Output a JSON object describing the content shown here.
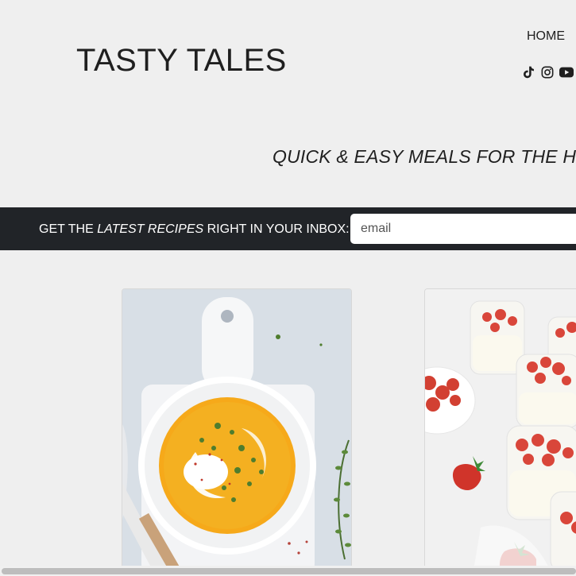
{
  "header": {
    "title": "TASTY TALES",
    "nav": {
      "home_label": "HOME"
    },
    "social_icons": [
      "tiktok-icon",
      "instagram-icon",
      "youtube-icon"
    ]
  },
  "tagline": "QUICK & EASY MEALS FOR THE HO",
  "newsletter": {
    "text_before": "GET THE ",
    "text_emphasis": "LATEST RECIPES",
    "text_after": " RIGHT IN YOUR INBOX:",
    "email_placeholder": "email"
  },
  "colors": {
    "page_background": "#efefef",
    "newsletter_bar": "#212428",
    "text": "#1f1f1f"
  }
}
